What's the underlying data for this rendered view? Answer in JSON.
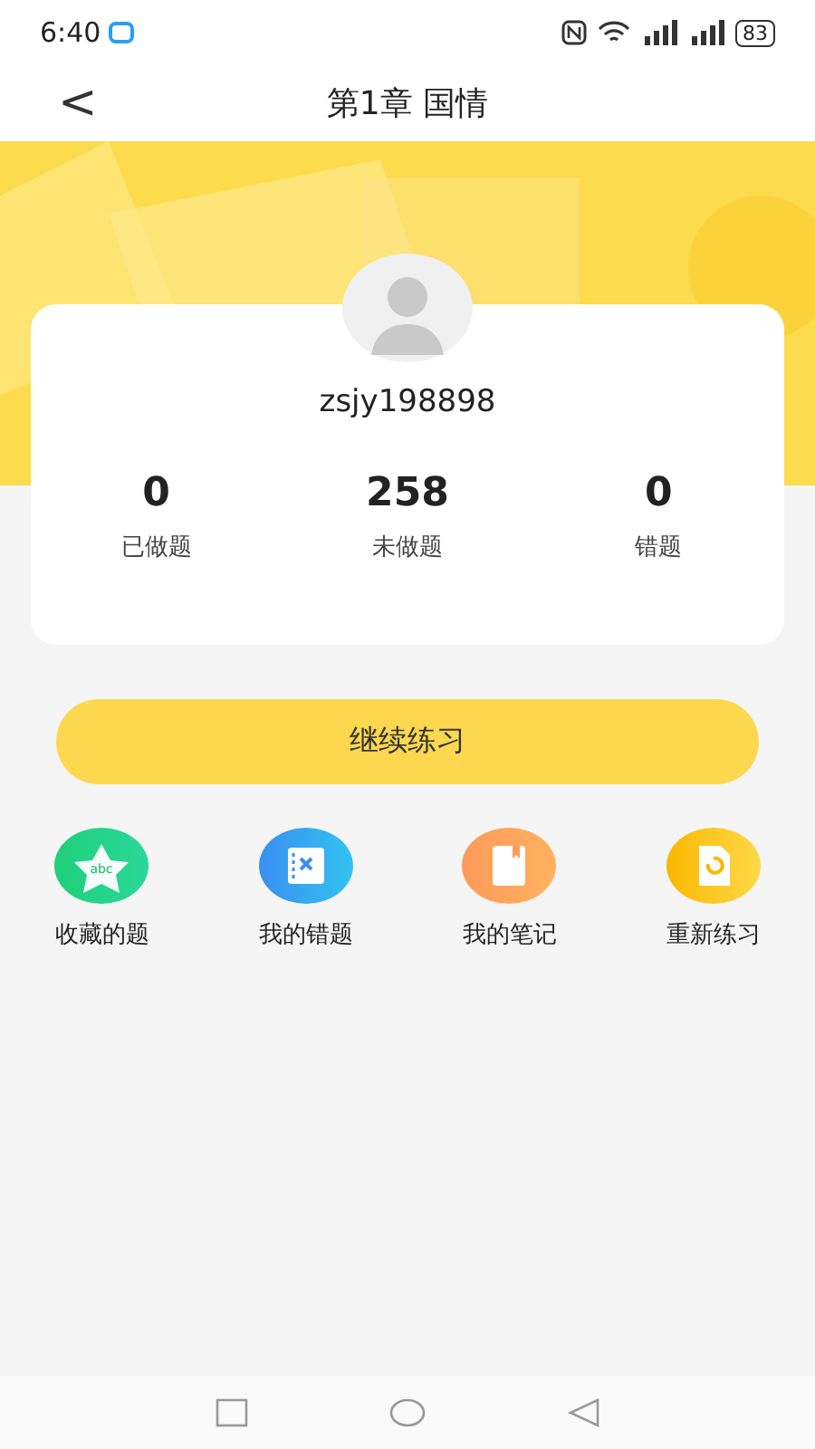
{
  "status_bar": {
    "time": "6:40",
    "battery": "83"
  },
  "header": {
    "back": "<",
    "title": "第1章 国情"
  },
  "profile": {
    "username": "zsjy198898"
  },
  "stats": [
    {
      "value": "0",
      "label": "已做题"
    },
    {
      "value": "258",
      "label": "未做题"
    },
    {
      "value": "0",
      "label": "错题"
    }
  ],
  "primary_button": "继续练习",
  "shortcuts": [
    {
      "kind": "star",
      "label": "收藏的题",
      "icon_text": "abc"
    },
    {
      "kind": "wrong",
      "label": "我的错题"
    },
    {
      "kind": "notes",
      "label": "我的笔记"
    },
    {
      "kind": "redo",
      "label": "重新练习"
    }
  ]
}
